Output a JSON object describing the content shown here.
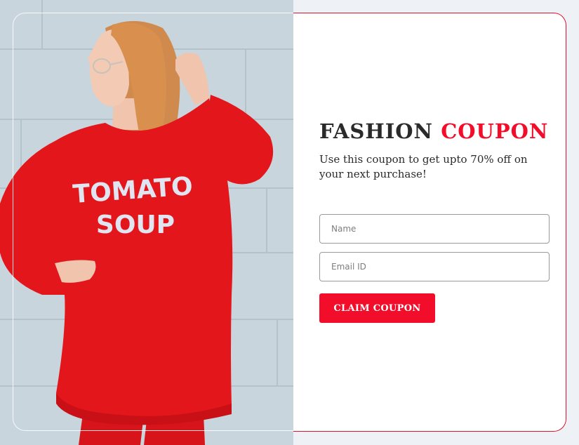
{
  "coupon": {
    "title_part1": "FASHION",
    "title_part2": "COUPON",
    "subtitle": "Use this coupon to get upto 70% off on your next purchase!",
    "name_placeholder": "Name",
    "email_placeholder": "Email ID",
    "button_label": "CLAIM COUPON"
  },
  "photo": {
    "shirt_text_line1": "TOMATO",
    "shirt_text_line2": "SOUP"
  },
  "colors": {
    "accent": "#f20d2a",
    "text": "#2a2a2a",
    "sweater": "#e3161b"
  }
}
